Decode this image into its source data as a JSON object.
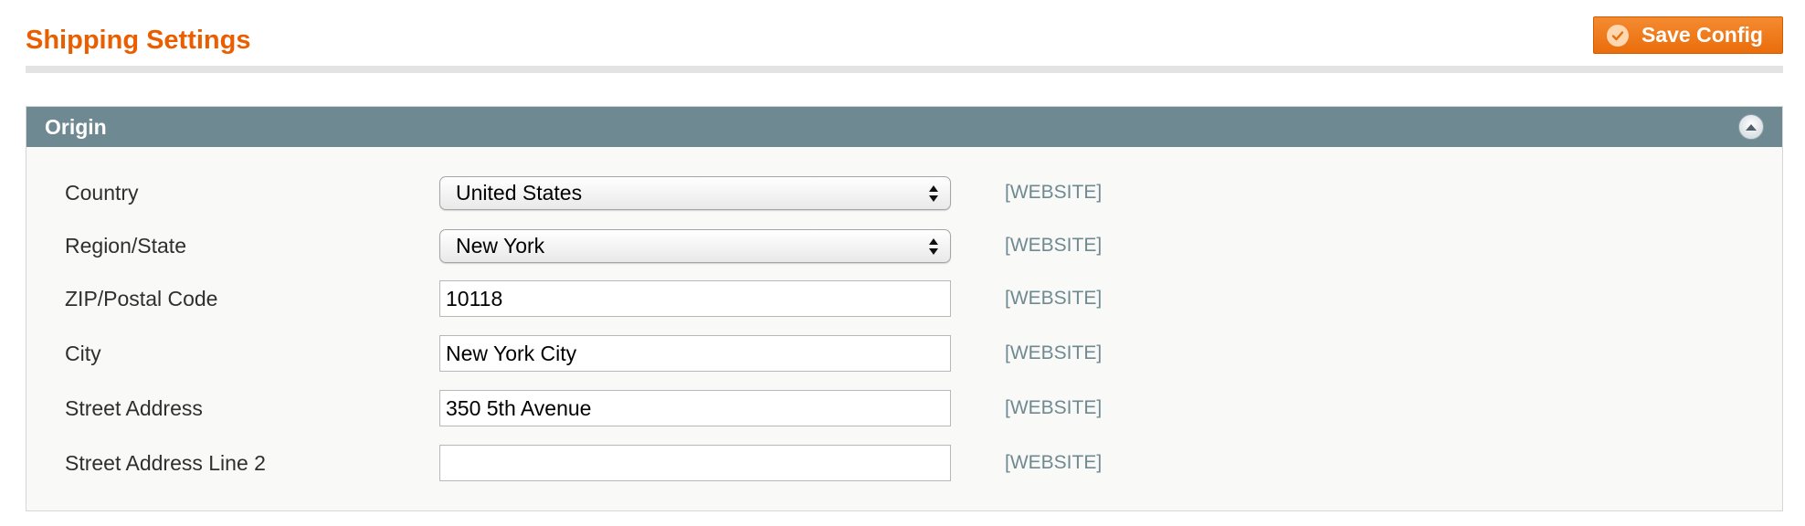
{
  "page": {
    "title": "Shipping Settings",
    "save_label": "Save Config"
  },
  "section": {
    "title": "Origin"
  },
  "fields": {
    "country": {
      "label": "Country",
      "value": "United States",
      "scope": "[WEBSITE]"
    },
    "region": {
      "label": "Region/State",
      "value": "New York",
      "scope": "[WEBSITE]"
    },
    "zip": {
      "label": "ZIP/Postal Code",
      "value": "10118",
      "scope": "[WEBSITE]"
    },
    "city": {
      "label": "City",
      "value": "New York City",
      "scope": "[WEBSITE]"
    },
    "street1": {
      "label": "Street Address",
      "value": "350 5th Avenue",
      "scope": "[WEBSITE]"
    },
    "street2": {
      "label": "Street Address Line 2",
      "value": "",
      "scope": "[WEBSITE]"
    }
  },
  "icons": {
    "save": "check-circle-icon",
    "collapse": "chevron-up-circle-icon",
    "select_arrows": "select-arrows-icon"
  },
  "colors": {
    "title": "#eb5e00",
    "accent_button": "#ea6d0b",
    "section_header": "#6f8992",
    "scope_text": "#6f8992"
  }
}
